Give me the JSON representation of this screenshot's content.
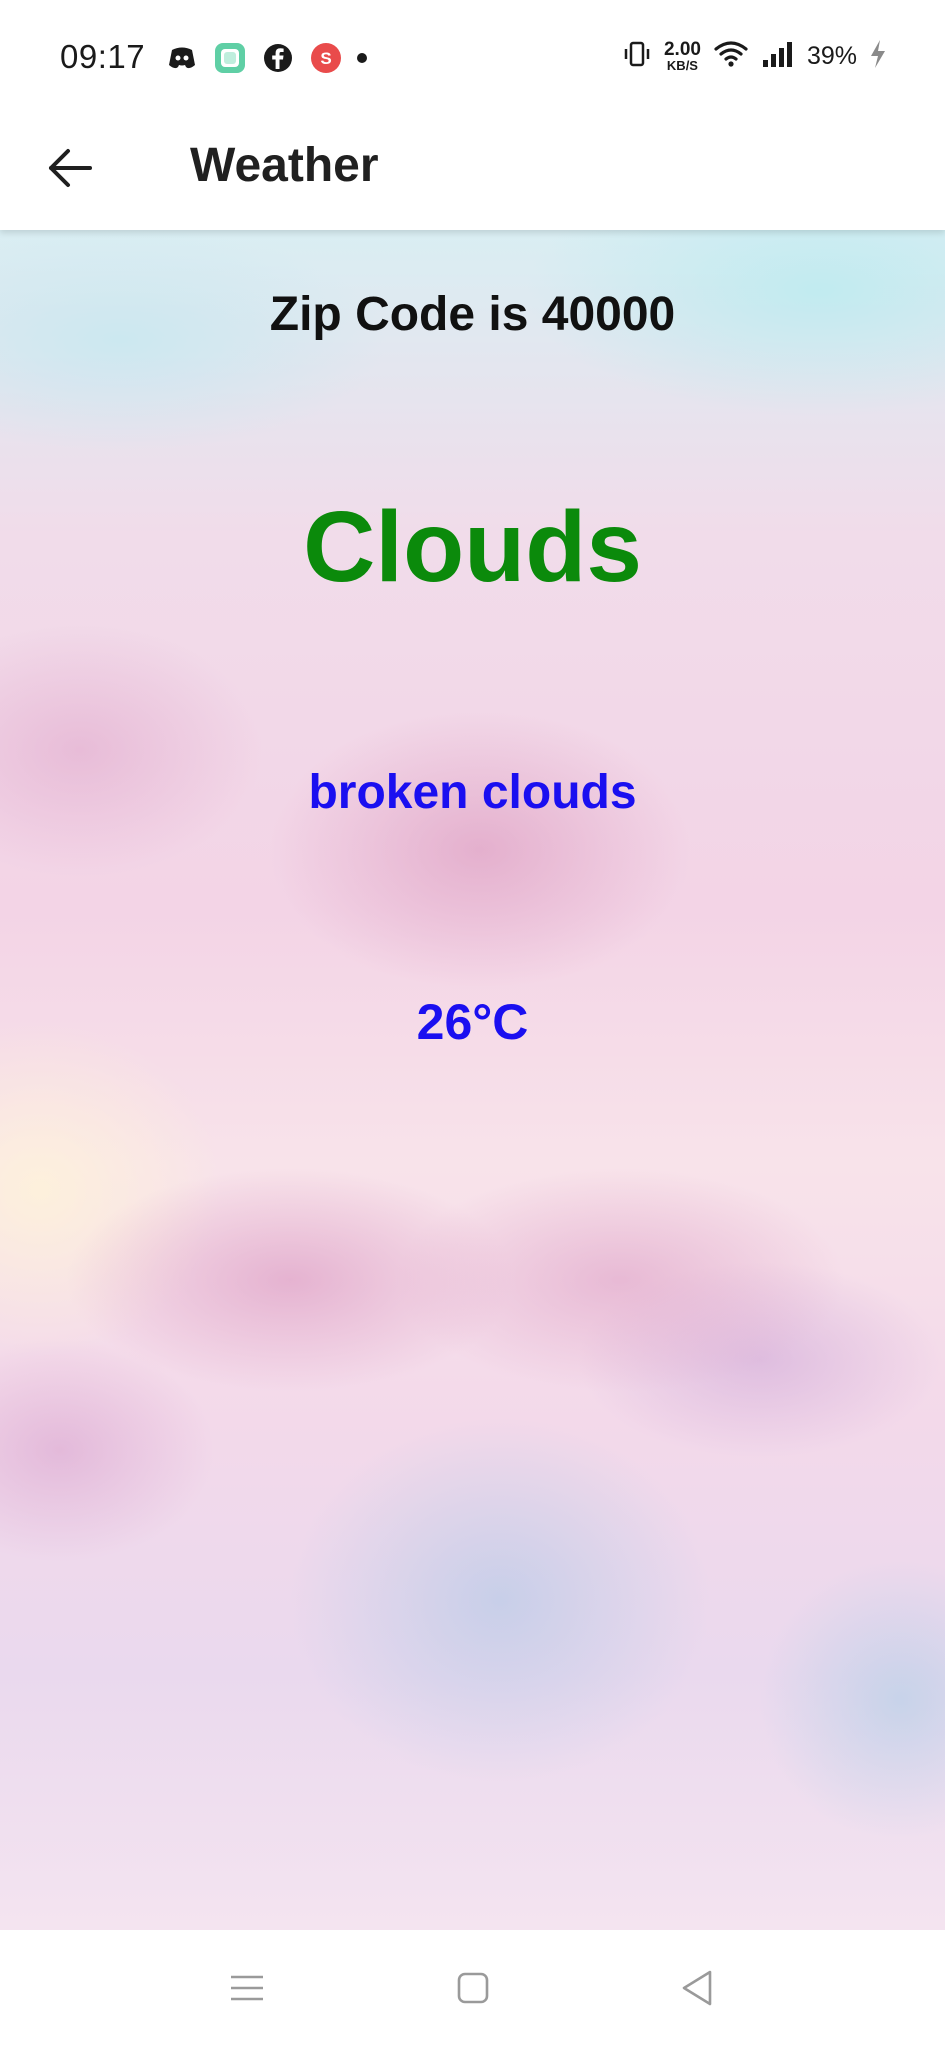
{
  "status_bar": {
    "time": "09:17",
    "net_speed_value": "2.00",
    "net_speed_unit": "KB/S",
    "battery_percent": "39%",
    "notification_icons": [
      "discord-icon",
      "chat-app-icon",
      "facebook-icon",
      "shazam-icon",
      "more-notifications-dot"
    ],
    "system_icons": [
      "vibrate-icon",
      "wifi-icon",
      "signal-icon",
      "charging-icon"
    ]
  },
  "app_bar": {
    "title": "Weather",
    "back_icon": "arrow-left-icon"
  },
  "weather": {
    "zip_line": "Zip Code is 40000",
    "main": "Clouds",
    "description": "broken clouds",
    "temperature": "26°C"
  },
  "colors": {
    "main_text": "#0b8a0b",
    "description_text": "#1a0ff0",
    "temperature_text": "#1a0ff0"
  },
  "nav_bar": {
    "icons": [
      "menu-icon",
      "home-square-icon",
      "back-triangle-icon"
    ]
  }
}
